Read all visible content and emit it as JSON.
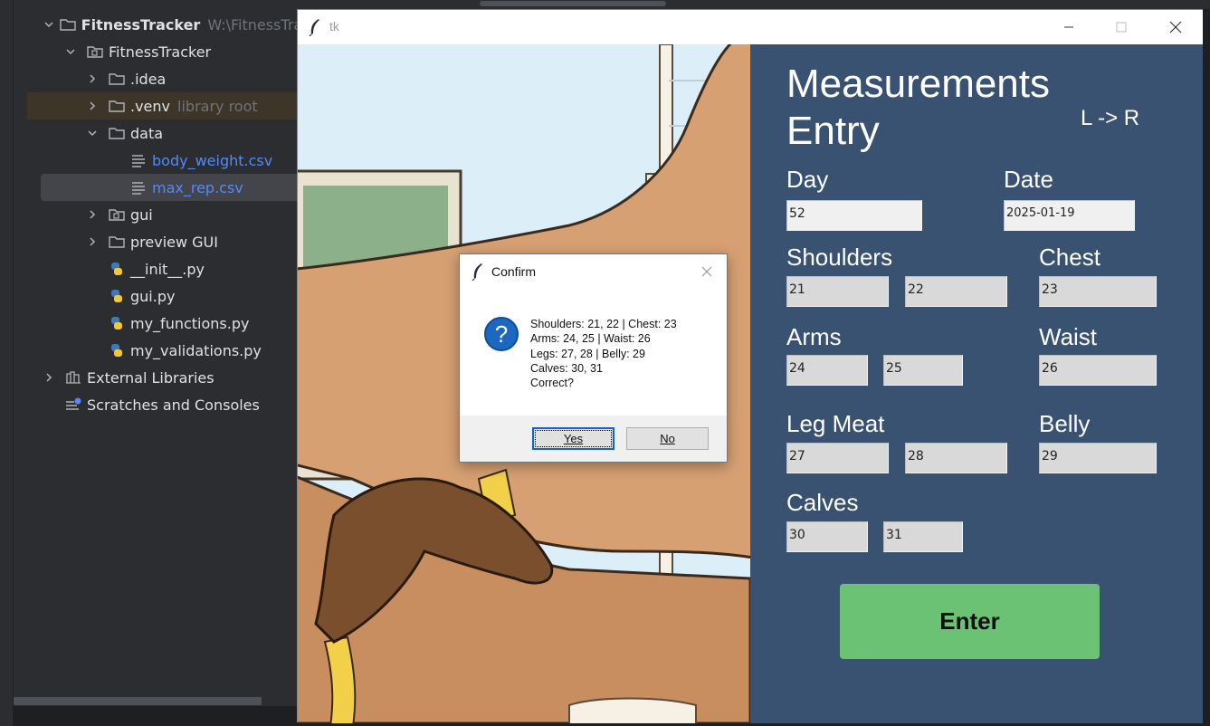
{
  "ide": {
    "tree": [
      {
        "label": "FitnessTracker",
        "suffix": "W:\\FitnessTrac",
        "kind": "project-root"
      },
      {
        "label": "FitnessTracker",
        "kind": "module-folder"
      },
      {
        "label": ".idea",
        "kind": "folder"
      },
      {
        "label": ".venv",
        "suffix": "library root",
        "kind": "folder"
      },
      {
        "label": "data",
        "kind": "folder"
      },
      {
        "label": "body_weight.csv",
        "kind": "csv-file"
      },
      {
        "label": "max_rep.csv",
        "kind": "csv-file"
      },
      {
        "label": "gui",
        "kind": "module-folder"
      },
      {
        "label": "preview GUI",
        "kind": "folder"
      },
      {
        "label": "__init__.py",
        "kind": "python-file"
      },
      {
        "label": "gui.py",
        "kind": "python-file"
      },
      {
        "label": "my_functions.py",
        "kind": "python-file"
      },
      {
        "label": "my_validations.py",
        "kind": "python-file"
      },
      {
        "label": "External Libraries",
        "kind": "libraries"
      },
      {
        "label": "Scratches and Consoles",
        "kind": "scratches"
      }
    ]
  },
  "tk_window": {
    "title": "tk",
    "heading": "Measurements Entry",
    "direction_note": "L -> R",
    "labels": {
      "day": "Day",
      "date": "Date",
      "shoulders": "Shoulders",
      "chest": "Chest",
      "arms": "Arms",
      "waist": "Waist",
      "leg_meat": "Leg Meat",
      "belly": "Belly",
      "calves": "Calves"
    },
    "values": {
      "day": "52",
      "date": "2025-01-19",
      "shoulders_l": "21",
      "shoulders_r": "22",
      "chest": "23",
      "arms_l": "24",
      "arms_r": "25",
      "waist": "26",
      "leg_l": "27",
      "leg_r": "28",
      "belly": "29",
      "calves_l": "30",
      "calves_r": "31"
    },
    "enter_label": "Enter"
  },
  "dialog": {
    "title": "Confirm",
    "message_lines": [
      "Shoulders: 21, 22 | Chest: 23",
      "Arms: 24, 25 | Waist: 26",
      "Legs: 27, 28 | Belly: 29",
      "Calves: 30, 31",
      "Correct?"
    ],
    "yes_label": "Yes",
    "no_label": "No"
  },
  "colors": {
    "panel_bg": "#3a5272",
    "enter_bg": "#6cc274",
    "ide_bg": "#2b2d30"
  }
}
